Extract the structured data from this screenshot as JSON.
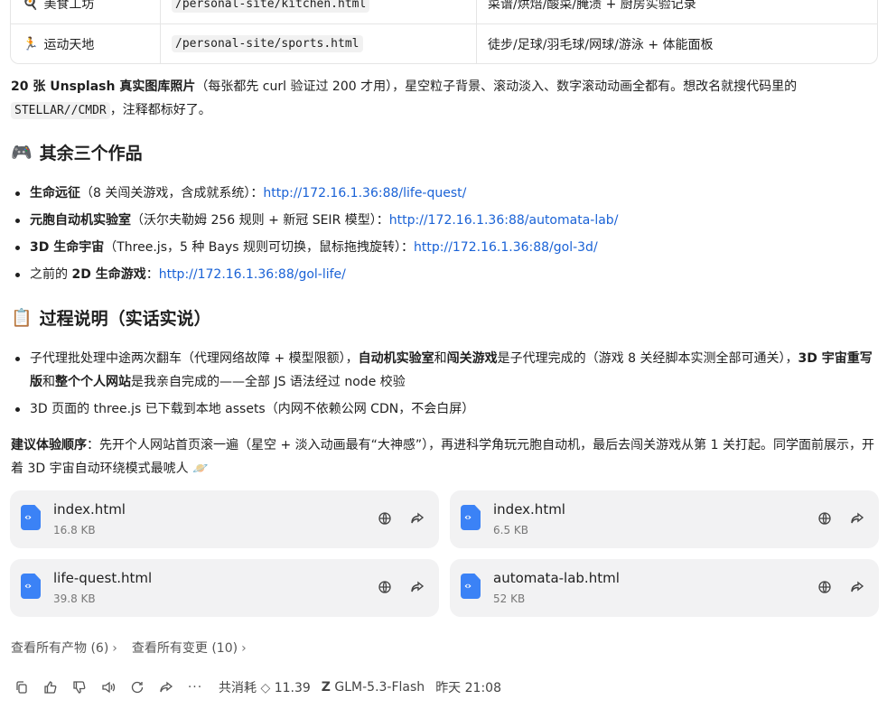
{
  "table": {
    "rows": [
      {
        "icon": "🍳",
        "name": "美食工坊",
        "path": "/personal-site/kitchen.html",
        "desc": "菜谱/烘焙/酸菜/腌渍 + 厨房实验记录"
      },
      {
        "icon": "🏃",
        "name": "运动天地",
        "path": "/personal-site/sports.html",
        "desc": "徒步/足球/羽毛球/网球/游泳 + 体能面板"
      }
    ]
  },
  "intro": {
    "bold": "20 张 Unsplash 真实图库照片",
    "text1": "（每张都先 curl 验证过 200 才用），星空粒子背景、滚动淡入、数字滚动动画全都有。想改名就搜代码里的 ",
    "code": "STELLAR//CMDR",
    "text2": "，注释都标好了。"
  },
  "section1": {
    "emoji": "🎮",
    "title": "其余三个作品",
    "items": [
      {
        "bold": "生命远征",
        "text": "（8 关闯关游戏，含成就系统）：",
        "link": "http://172.16.1.36:88/life-quest/"
      },
      {
        "bold": "元胞自动机实验室",
        "text": "（沃尔夫勒姆 256 规则 + 新冠 SEIR 模型）：",
        "link": "http://172.16.1.36:88/automata-lab/"
      },
      {
        "bold": "3D 生命宇宙",
        "text": "（Three.js，5 种 Bays 规则可切换，鼠标拖拽旋转）：",
        "link": "http://172.16.1.36:88/gol-3d/"
      },
      {
        "prefix": "之前的 ",
        "bold": "2D 生命游戏",
        "text": "：",
        "link": "http://172.16.1.36:88/gol-life/"
      }
    ]
  },
  "section2": {
    "emoji": "📋",
    "title": "过程说明（实话实说）",
    "item1": {
      "t1": "子代理批处理中途两次翻车（代理网络故障 + 模型限额），",
      "b1": "自动机实验室",
      "t2": "和",
      "b2": "闯关游戏",
      "t3": "是子代理完成的（游戏 8 关经脚本实测全部可通关），",
      "b3": "3D 宇宙重写版",
      "t4": "和",
      "b4": "整个个人网站",
      "t5": "是我亲自完成的——全部 JS 语法经过 node 校验"
    },
    "item2": "3D 页面的 three.js 已下载到本地 assets（内网不依赖公网 CDN，不会白屏）"
  },
  "suggest": {
    "bold": "建议体验顺序",
    "text": "：先开个人网站首页滚一遍（星空 + 淡入动画最有“大神感”），再进科学角玩元胞自动机，最后去闯关游戏从第 1 关打起。同学面前展示，开着 3D 宇宙自动环绕模式最唬人 🪐"
  },
  "files": [
    {
      "name": "index.html",
      "size": "16.8 KB"
    },
    {
      "name": "index.html",
      "size": "6.5 KB"
    },
    {
      "name": "life-quest.html",
      "size": "39.8 KB"
    },
    {
      "name": "automata-lab.html",
      "size": "52 KB"
    }
  ],
  "links": {
    "artifacts": "查看所有产物 (6)",
    "changes": "查看所有变更 (10)"
  },
  "footer": {
    "cost_label": "共消耗",
    "cost_value": "11.39",
    "model": "GLM-5.3-Flash",
    "time": "昨天 21:08"
  }
}
